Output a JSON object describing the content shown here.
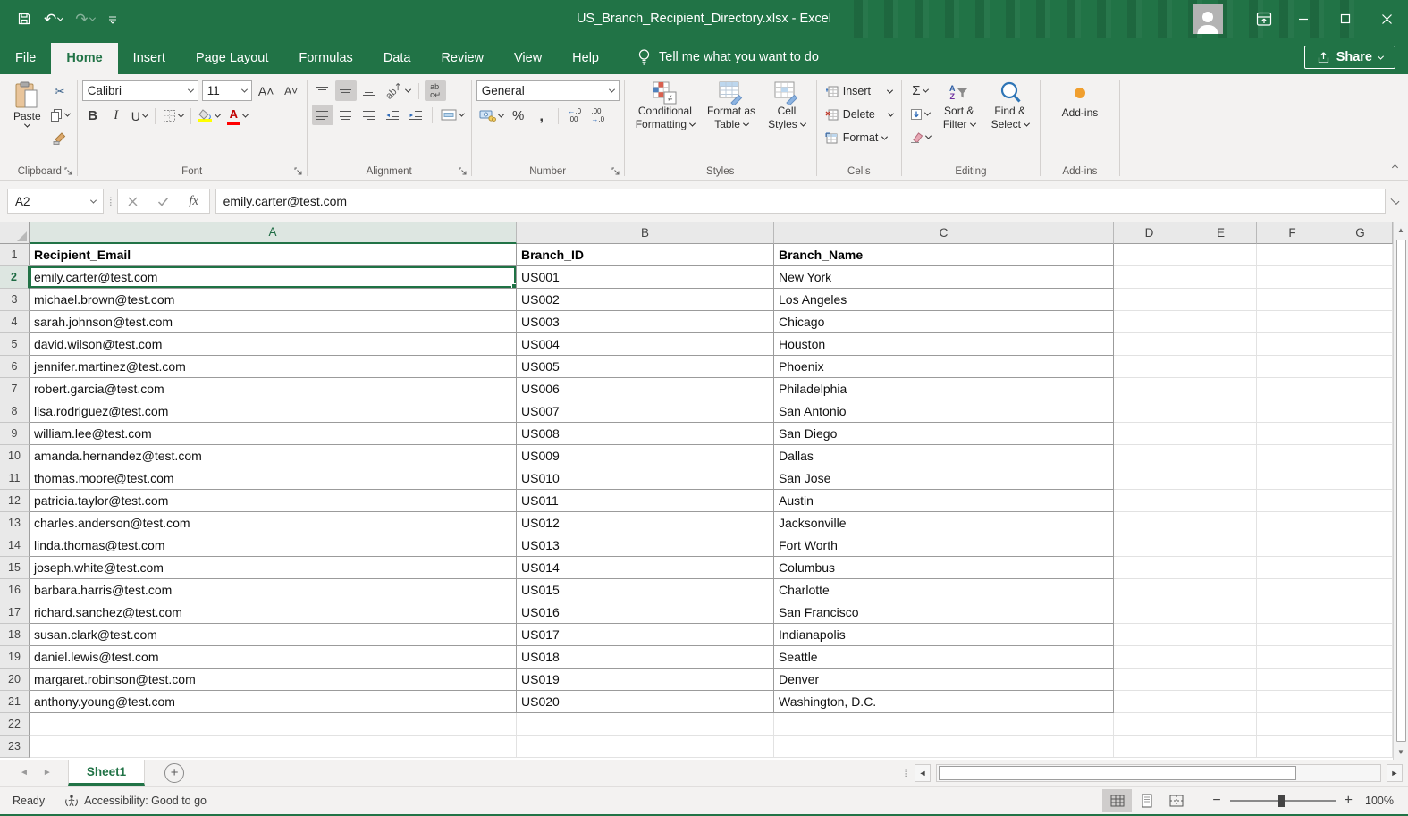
{
  "window": {
    "title": "US_Branch_Recipient_Directory.xlsx  -  Excel"
  },
  "tabs": {
    "items": [
      "File",
      "Home",
      "Insert",
      "Page Layout",
      "Formulas",
      "Data",
      "Review",
      "View",
      "Help"
    ],
    "active": "Home",
    "tell_me": "Tell me what you want to do",
    "share": "Share"
  },
  "ribbon": {
    "clipboard": {
      "label": "Clipboard",
      "paste": "Paste"
    },
    "font": {
      "label": "Font",
      "family": "Calibri",
      "size": "11",
      "bold": "B",
      "italic": "I",
      "underline": "U"
    },
    "alignment": {
      "label": "Alignment"
    },
    "number": {
      "label": "Number",
      "format": "General",
      "percent": "%",
      "comma": ","
    },
    "styles": {
      "label": "Styles",
      "conditional_1": "Conditional",
      "conditional_2": "Formatting",
      "format_table_1": "Format as",
      "format_table_2": "Table",
      "cell_styles_1": "Cell",
      "cell_styles_2": "Styles"
    },
    "cells": {
      "label": "Cells",
      "insert": "Insert",
      "delete": "Delete",
      "format": "Format"
    },
    "editing": {
      "label": "Editing",
      "autosum": "Σ",
      "sort_1": "Sort &",
      "sort_2": "Filter",
      "find_1": "Find &",
      "find_2": "Select"
    },
    "addins": {
      "label": "Add-ins",
      "button": "Add-ins"
    }
  },
  "formula_bar": {
    "name_box": "A2",
    "fx": "fx",
    "value": "emily.carter@test.com"
  },
  "grid": {
    "columns": [
      "A",
      "B",
      "C",
      "D",
      "E",
      "F",
      "G"
    ],
    "headers": [
      "Recipient_Email",
      "Branch_ID",
      "Branch_Name"
    ],
    "rows": [
      {
        "email": "emily.carter@test.com",
        "id": "US001",
        "city": "New York"
      },
      {
        "email": "michael.brown@test.com",
        "id": "US002",
        "city": "Los Angeles"
      },
      {
        "email": "sarah.johnson@test.com",
        "id": "US003",
        "city": "Chicago"
      },
      {
        "email": "david.wilson@test.com",
        "id": "US004",
        "city": "Houston"
      },
      {
        "email": "jennifer.martinez@test.com",
        "id": "US005",
        "city": "Phoenix"
      },
      {
        "email": "robert.garcia@test.com",
        "id": "US006",
        "city": "Philadelphia"
      },
      {
        "email": "lisa.rodriguez@test.com",
        "id": "US007",
        "city": "San Antonio"
      },
      {
        "email": "william.lee@test.com",
        "id": "US008",
        "city": "San Diego"
      },
      {
        "email": "amanda.hernandez@test.com",
        "id": "US009",
        "city": "Dallas"
      },
      {
        "email": "thomas.moore@test.com",
        "id": "US010",
        "city": "San Jose"
      },
      {
        "email": "patricia.taylor@test.com",
        "id": "US011",
        "city": "Austin"
      },
      {
        "email": "charles.anderson@test.com",
        "id": "US012",
        "city": "Jacksonville"
      },
      {
        "email": "linda.thomas@test.com",
        "id": "US013",
        "city": "Fort Worth"
      },
      {
        "email": "joseph.white@test.com",
        "id": "US014",
        "city": "Columbus"
      },
      {
        "email": "barbara.harris@test.com",
        "id": "US015",
        "city": "Charlotte"
      },
      {
        "email": "richard.sanchez@test.com",
        "id": "US016",
        "city": "San Francisco"
      },
      {
        "email": "susan.clark@test.com",
        "id": "US017",
        "city": "Indianapolis"
      },
      {
        "email": "daniel.lewis@test.com",
        "id": "US018",
        "city": "Seattle"
      },
      {
        "email": "margaret.robinson@test.com",
        "id": "US019",
        "city": "Denver"
      },
      {
        "email": "anthony.young@test.com",
        "id": "US020",
        "city": "Washington, D.C."
      }
    ],
    "visible_rows": 23,
    "selected": {
      "col": "A",
      "row": 2,
      "ref": "A2"
    }
  },
  "sheet_bar": {
    "tabs": [
      "Sheet1"
    ],
    "active": "Sheet1"
  },
  "status_bar": {
    "mode": "Ready",
    "accessibility": "Accessibility: Good to go",
    "zoom": "100%"
  },
  "colors": {
    "excel_green": "#217346",
    "selection": "#1f7245",
    "fill_yellow": "#ffff00",
    "font_red": "#ff0000",
    "addins_orange": "#f09f2e"
  }
}
